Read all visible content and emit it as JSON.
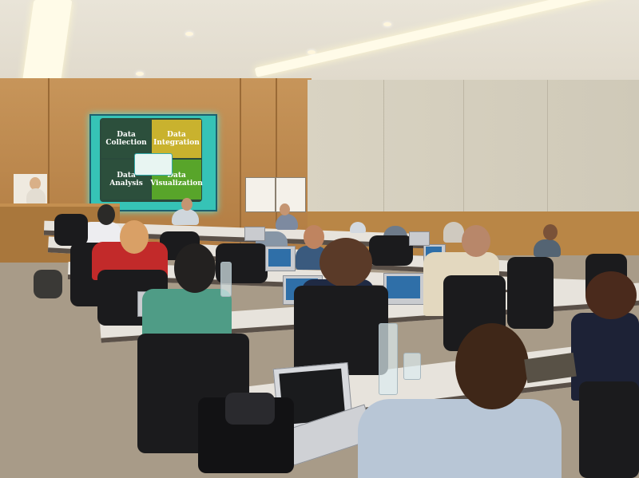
{
  "scene": {
    "description_title": "",
    "slide": {
      "quadrants": [
        {
          "label": "Data\nCollection",
          "color": "#2c4f3c"
        },
        {
          "label": "Data\nIntegration",
          "color": "#c9b22e"
        },
        {
          "label": "Data\nAnalysis",
          "color": "#2c4f3c"
        },
        {
          "label": "Data\nVisualization",
          "color": "#58a52a"
        }
      ],
      "background_color": "#36c3b6"
    },
    "colors": {
      "wood": "#b98646",
      "wall": "#d6cfbe",
      "floor": "#a89b88",
      "desk": "#e7e3dc",
      "chair": "#1b1b1d"
    }
  }
}
